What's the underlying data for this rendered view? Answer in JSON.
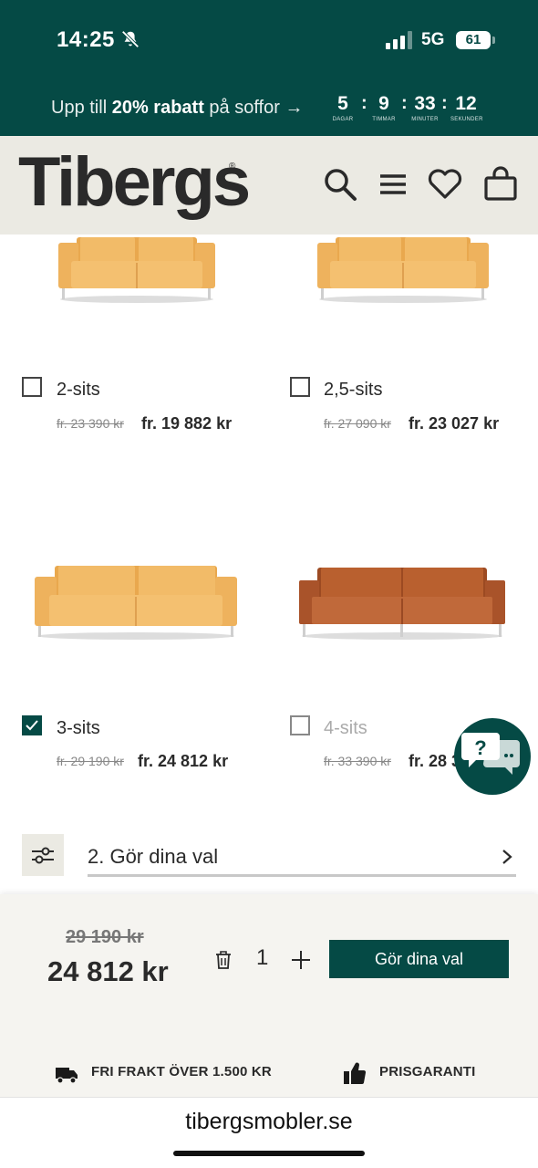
{
  "status_bar": {
    "time": "14:25",
    "network": "5G",
    "battery": "61",
    "icons": [
      "bell-slash-icon",
      "signal-icon"
    ]
  },
  "promo": {
    "prefix": "Upp till",
    "highlight": "20% rabatt",
    "suffix": "på soffor →",
    "countdown": [
      {
        "value": "5",
        "unit": "DAGAR"
      },
      {
        "value": "9",
        "unit": "TIMMAR"
      },
      {
        "value": "33",
        "unit": "MINUTER"
      },
      {
        "value": "12",
        "unit": "SEKUNDER"
      }
    ]
  },
  "header": {
    "logo": "Tibergs",
    "logo_mark": "®",
    "icons": [
      "search-icon",
      "menu-icon",
      "heart-icon",
      "cart-icon"
    ]
  },
  "products": [
    {
      "label": "2-sits",
      "old_price": "fr. 23 390 kr",
      "price": "fr. 19 882 kr",
      "checked": false,
      "available": true,
      "color": "#f0b865"
    },
    {
      "label": "2,5-sits",
      "old_price": "fr. 27 090 kr",
      "price": "fr. 23 027 kr",
      "checked": false,
      "available": true,
      "color": "#f0b865"
    },
    {
      "label": "3-sits",
      "old_price": "fr. 29 190 kr",
      "price": "fr. 24 812 kr",
      "checked": true,
      "available": true,
      "color": "#f0b865"
    },
    {
      "label": "4-sits",
      "old_price": "fr. 33 390 kr",
      "price": "fr. 28 3",
      "checked": false,
      "available": false,
      "color": "#b25a2c"
    }
  ],
  "chat": {
    "icon": "chat-help-icon",
    "glyph": "?"
  },
  "step": {
    "label": "2. Gör dina val"
  },
  "purchase": {
    "old_total": "29 190 kr",
    "total": "24 812 kr",
    "quantity": "1",
    "cta": "Gör dina val"
  },
  "usps": [
    {
      "icon": "truck-icon",
      "text": "FRI FRAKT ÖVER 1.500 KR"
    },
    {
      "icon": "thumbs-up-icon",
      "text": "PRISGARANTI"
    }
  ],
  "browser": {
    "url": "tibergsmobler.se"
  },
  "colors": {
    "brand": "#054a45",
    "header_bg": "#ebeae3",
    "leather_light": "#f0b865",
    "leather_dark": "#b25a2c"
  }
}
